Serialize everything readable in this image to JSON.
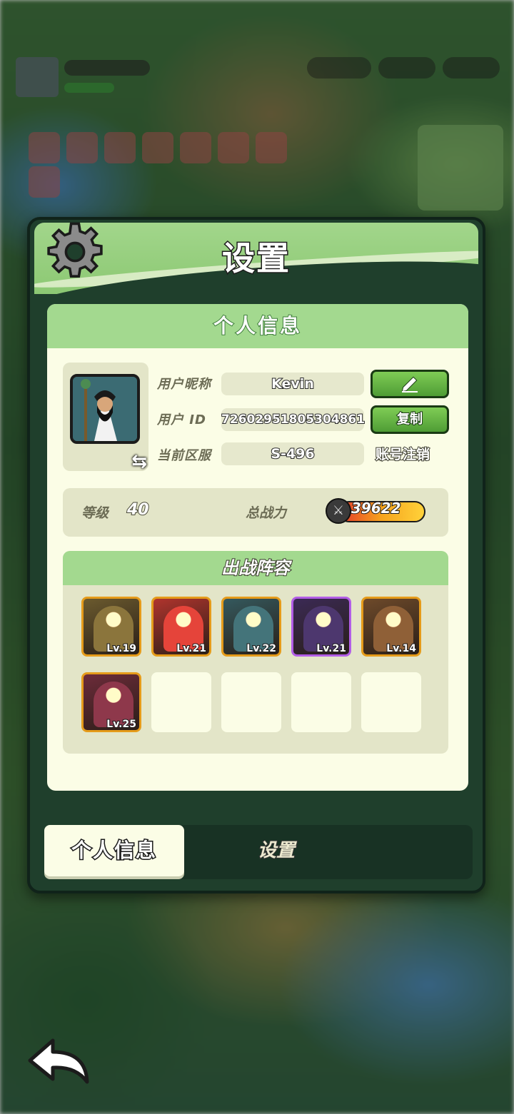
{
  "dialog": {
    "title": "设置",
    "card_title": "个人信息",
    "nickname_label": "用户昵称",
    "nickname_value": "Kevin",
    "id_label": "用户 ID",
    "id_value": "7260295180530486\u00001",
    "server_label": "当前区服",
    "server_value": "S-496",
    "copy_label": "复制",
    "delete_account_label": "账号注销",
    "level_label": "等级",
    "level_value": "40",
    "power_label": "总战力",
    "power_value": "39622",
    "lineup_title": "出战阵容",
    "heroes": [
      {
        "level": "Lv.19",
        "rarity": "gold",
        "color": "#6b5a2e"
      },
      {
        "level": "Lv.21",
        "rarity": "gold",
        "color": "#b0342d"
      },
      {
        "level": "Lv.22",
        "rarity": "gold",
        "color": "#34595e"
      },
      {
        "level": "Lv.21",
        "rarity": "purple",
        "color": "#3b2a55"
      },
      {
        "level": "Lv.14",
        "rarity": "gold",
        "color": "#6e4a2a"
      },
      {
        "level": "Lv.25",
        "rarity": "gold",
        "color": "#6d2b3a"
      }
    ],
    "empty_slots": 4
  },
  "tabs": {
    "active": "个人信息",
    "other": "设置"
  },
  "icons": {
    "settings": "gear-icon",
    "edit": "pencil-icon",
    "swap": "swap-arrows-icon",
    "power": "crossed-swords-icon",
    "back": "back-arrow-icon"
  }
}
